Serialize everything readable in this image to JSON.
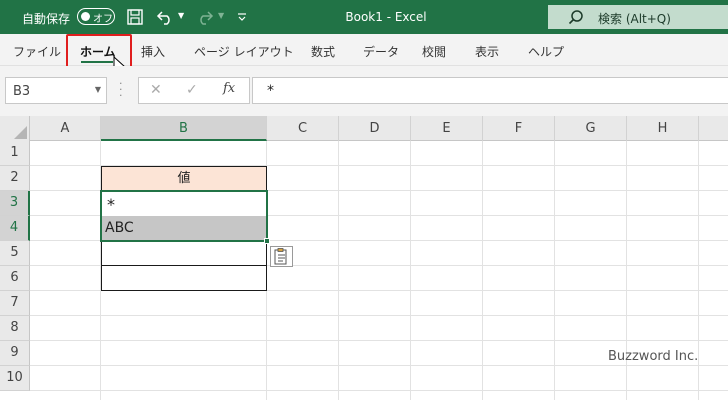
{
  "titlebar": {
    "autosave_label": "自動保存",
    "autosave_toggle": "オフ",
    "doc_title": "Book1  -  Excel",
    "search_text": "検索 (Alt+Q)"
  },
  "ribbon": {
    "tabs": [
      {
        "label": "ファイル",
        "active": false
      },
      {
        "label": "ホーム",
        "active": true
      },
      {
        "label": "挿入",
        "active": false
      },
      {
        "label": "ページ レイアウト",
        "active": false
      },
      {
        "label": "数式",
        "active": false
      },
      {
        "label": "データ",
        "active": false
      },
      {
        "label": "校閲",
        "active": false
      },
      {
        "label": "表示",
        "active": false
      },
      {
        "label": "ヘルプ",
        "active": false
      }
    ]
  },
  "formula_bar": {
    "name_box": "B3",
    "fx_label": "fx",
    "content": "*"
  },
  "sheet": {
    "columns": [
      "A",
      "B",
      "C",
      "D",
      "E",
      "F",
      "G",
      "H"
    ],
    "selected_column": "B",
    "rows": [
      "1",
      "2",
      "3",
      "4",
      "5",
      "6",
      "7",
      "8",
      "9",
      "10"
    ],
    "selected_rows": [
      "3",
      "4"
    ],
    "cells": {
      "B2": "値",
      "B3": "*",
      "B4": "ABC"
    }
  },
  "watermark": "Buzzword Inc.",
  "colors": {
    "excel_green": "#217346",
    "header_fill": "#fce4d6",
    "selected_fill": "#c6c6c6",
    "highlight_red": "#e01e1e"
  }
}
